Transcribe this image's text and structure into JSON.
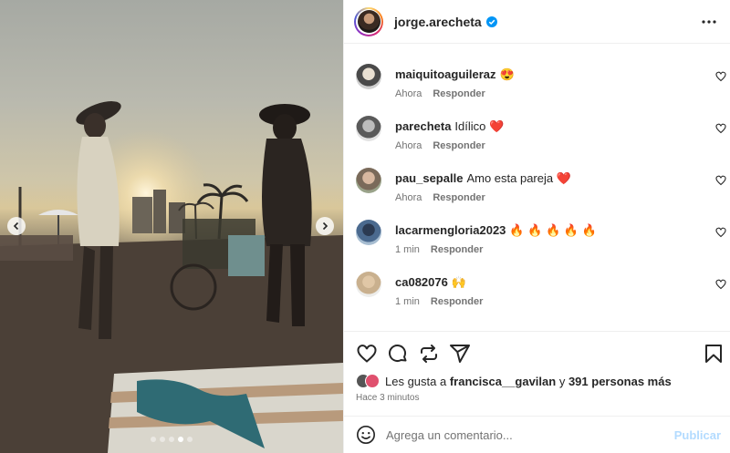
{
  "post": {
    "username": "jorge.arecheta",
    "media_page": 4,
    "media_pages_total": 5
  },
  "comments": [
    {
      "user": "maiquitoaguileraz",
      "text": "😍",
      "time": "Ahora",
      "reply": "Responder"
    },
    {
      "user": "parecheta",
      "text": "Idílico ❤️",
      "time": "Ahora",
      "reply": "Responder"
    },
    {
      "user": "pau_sepalle",
      "text": "Amo esta pareja ❤️",
      "time": "Ahora",
      "reply": "Responder"
    },
    {
      "user": "lacarmengloria2023",
      "text": "🔥 🔥 🔥 🔥 🔥",
      "time": "1 min",
      "reply": "Responder"
    },
    {
      "user": "ca082076",
      "text": "🙌",
      "time": "1 min",
      "reply": "Responder"
    }
  ],
  "likes": {
    "prefix": "Les gusta a",
    "user": "francisca__gavilan",
    "joiner": "y",
    "others": "391 personas más"
  },
  "timestamp": "Hace 3 minutos",
  "add_comment": {
    "placeholder": "Agrega un comentario...",
    "publish_label": "Publicar"
  },
  "icons": {
    "verified": "verified-badge-icon",
    "more": "more-options-icon",
    "like": "heart-icon",
    "comment": "comment-icon",
    "repost": "repost-icon",
    "share": "share-icon",
    "save": "bookmark-icon",
    "emoji": "emoji-icon"
  },
  "colors": {
    "verified_blue": "#0095f6",
    "publish_disabled": "#b3dbff",
    "secondary_text": "#737373"
  }
}
